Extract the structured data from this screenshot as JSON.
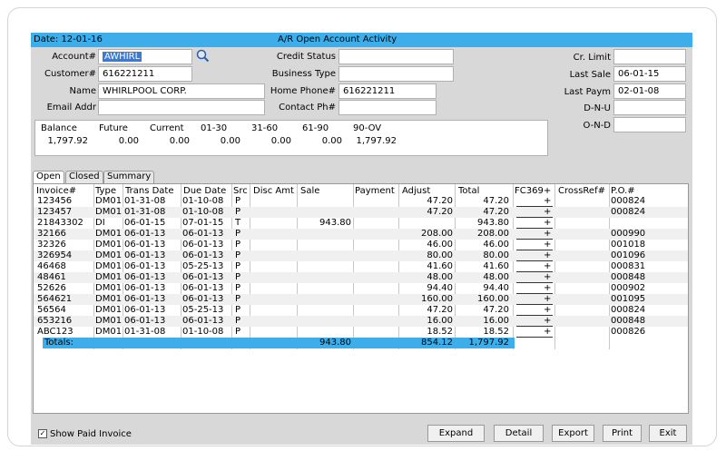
{
  "window": {
    "date_label": "Date: 12-01-16",
    "title": "A/R Open Account Activity"
  },
  "fields": {
    "account_label": "Account#",
    "account_value": "AWHIRL",
    "customer_label": "Customer#",
    "customer_value": "616221211",
    "name_label": "Name",
    "name_value": "WHIRLPOOL CORP.",
    "email_label": "Email Addr",
    "email_value": "",
    "credit_status_label": "Credit Status",
    "credit_status_value": "",
    "business_type_label": "Business Type",
    "business_type_value": "",
    "home_phone_label": "Home Phone#",
    "home_phone_value": "616221211",
    "contact_ph_label": "Contact Ph#",
    "contact_ph_value": "",
    "cr_limit_label": "Cr. Limit",
    "cr_limit_value": "",
    "last_sale_label": "Last Sale",
    "last_sale_value": "06-01-15",
    "last_paym_label": "Last Paym",
    "last_paym_value": "02-01-08",
    "dnu_label": "D-N-U",
    "dnu_value": "",
    "ond_label": "O-N-D",
    "ond_value": ""
  },
  "balance": {
    "headers": [
      "Balance",
      "Future",
      "Current",
      "01-30",
      "31-60",
      "61-90",
      "90-OV"
    ],
    "values": [
      "1,797.92",
      "0.00",
      "0.00",
      "0.00",
      "0.00",
      "0.00",
      "1,797.92"
    ]
  },
  "tabs": [
    "Open",
    "Closed",
    "Summary"
  ],
  "grid": {
    "headers": [
      "Invoice#",
      "Type",
      "Trans Date",
      "Due Date",
      "Src",
      "Disc Amt",
      "Sale",
      "Payment",
      "Adjust",
      "Total",
      "FC369+",
      "CrossRef#",
      "P.O.#"
    ],
    "rows": [
      {
        "invoice": "123456",
        "type": "DM01",
        "trans": "01-31-08",
        "due": "01-10-08",
        "src": "P",
        "disc": "",
        "sale": "",
        "payment": "",
        "adjust": "47.20",
        "total": "47.20",
        "fc": "+",
        "xref": "",
        "po": "000824"
      },
      {
        "invoice": "123457",
        "type": "DM01",
        "trans": "01-31-08",
        "due": "01-10-08",
        "src": "P",
        "disc": "",
        "sale": "",
        "payment": "",
        "adjust": "47.20",
        "total": "47.20",
        "fc": "+",
        "xref": "",
        "po": "000824"
      },
      {
        "invoice": "21843302",
        "type": "DI",
        "trans": "06-01-15",
        "due": "07-01-15",
        "src": "T",
        "disc": "",
        "sale": "943.80",
        "payment": "",
        "adjust": "",
        "total": "943.80",
        "fc": "+",
        "xref": "",
        "po": ""
      },
      {
        "invoice": "32166",
        "type": "DM01",
        "trans": "06-01-13",
        "due": "06-01-13",
        "src": "P",
        "disc": "",
        "sale": "",
        "payment": "",
        "adjust": "208.00",
        "total": "208.00",
        "fc": "+",
        "xref": "",
        "po": "000990"
      },
      {
        "invoice": "32326",
        "type": "DM01",
        "trans": "06-01-13",
        "due": "06-01-13",
        "src": "P",
        "disc": "",
        "sale": "",
        "payment": "",
        "adjust": "46.00",
        "total": "46.00",
        "fc": "+",
        "xref": "",
        "po": "001018"
      },
      {
        "invoice": "326954",
        "type": "DM01",
        "trans": "06-01-13",
        "due": "06-01-13",
        "src": "P",
        "disc": "",
        "sale": "",
        "payment": "",
        "adjust": "80.00",
        "total": "80.00",
        "fc": "+",
        "xref": "",
        "po": "001096"
      },
      {
        "invoice": "46468",
        "type": "DM01",
        "trans": "06-01-13",
        "due": "05-25-13",
        "src": "P",
        "disc": "",
        "sale": "",
        "payment": "",
        "adjust": "41.60",
        "total": "41.60",
        "fc": "+",
        "xref": "",
        "po": "000831"
      },
      {
        "invoice": "48461",
        "type": "DM01",
        "trans": "06-01-13",
        "due": "06-01-13",
        "src": "P",
        "disc": "",
        "sale": "",
        "payment": "",
        "adjust": "48.00",
        "total": "48.00",
        "fc": "+",
        "xref": "",
        "po": "000848"
      },
      {
        "invoice": "52626",
        "type": "DM01",
        "trans": "06-01-13",
        "due": "06-01-13",
        "src": "P",
        "disc": "",
        "sale": "",
        "payment": "",
        "adjust": "94.40",
        "total": "94.40",
        "fc": "+",
        "xref": "",
        "po": "000902"
      },
      {
        "invoice": "564621",
        "type": "DM01",
        "trans": "06-01-13",
        "due": "06-01-13",
        "src": "P",
        "disc": "",
        "sale": "",
        "payment": "",
        "adjust": "160.00",
        "total": "160.00",
        "fc": "+",
        "xref": "",
        "po": "001095"
      },
      {
        "invoice": "56564",
        "type": "DM01",
        "trans": "06-01-13",
        "due": "05-25-13",
        "src": "P",
        "disc": "",
        "sale": "",
        "payment": "",
        "adjust": "47.20",
        "total": "47.20",
        "fc": "+",
        "xref": "",
        "po": "000824"
      },
      {
        "invoice": "653216",
        "type": "DM01",
        "trans": "06-01-13",
        "due": "06-01-13",
        "src": "P",
        "disc": "",
        "sale": "",
        "payment": "",
        "adjust": "16.00",
        "total": "16.00",
        "fc": "+",
        "xref": "",
        "po": "000848"
      },
      {
        "invoice": "ABC123",
        "type": "DM01",
        "trans": "01-31-08",
        "due": "01-10-08",
        "src": "P",
        "disc": "",
        "sale": "",
        "payment": "",
        "adjust": "18.52",
        "total": "18.52",
        "fc": "+",
        "xref": "",
        "po": "000826"
      }
    ],
    "totals": {
      "label": "Totals:",
      "sale": "943.80",
      "adjust": "854.12",
      "total": "1,797.92"
    }
  },
  "footer": {
    "show_paid_label": "Show Paid Invoice",
    "show_paid_checked": "✓",
    "buttons": [
      "Expand",
      "Detail",
      "Export",
      "Print",
      "Exit"
    ]
  },
  "colors": {
    "title_bar": "#3daee9",
    "selection": "#3a7bd5",
    "panel": "#d8d8d8"
  },
  "icons": {
    "search": "search-icon"
  }
}
